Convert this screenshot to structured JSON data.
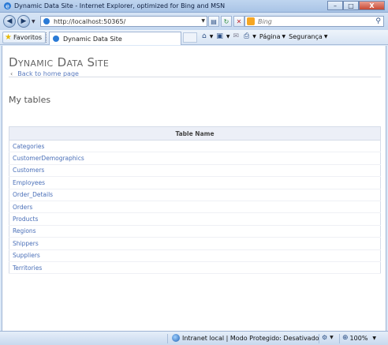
{
  "window": {
    "title": "Dynamic Data Site - Internet Explorer, optimized for Bing and MSN",
    "buttons": {
      "minimize": "–",
      "maximize": "□",
      "close": "X"
    }
  },
  "address_bar": {
    "url": "http://localhost:50365/",
    "search_placeholder": "Bing"
  },
  "command_bar": {
    "favorites_label": "Favoritos",
    "tab_label": "Dynamic Data Site",
    "page_menu": "Página",
    "safety_menu": "Segurança"
  },
  "page": {
    "site_title": "Dynamic Data Site",
    "back_link": "Back to home page",
    "heading": "My tables",
    "table_header": "Table Name",
    "tables": [
      "Categories",
      "CustomerDemographics",
      "Customers",
      "Employees",
      "Order_Details",
      "Orders",
      "Products",
      "Regions",
      "Shippers",
      "Suppliers",
      "Territories"
    ]
  },
  "status_bar": {
    "zone_text": "Intranet local | Modo Protegido: Desativado",
    "zoom": "100%"
  },
  "colors": {
    "link": "#4a6fb8",
    "header_bg": "#eceff7",
    "chrome": "#c5d8f0"
  }
}
